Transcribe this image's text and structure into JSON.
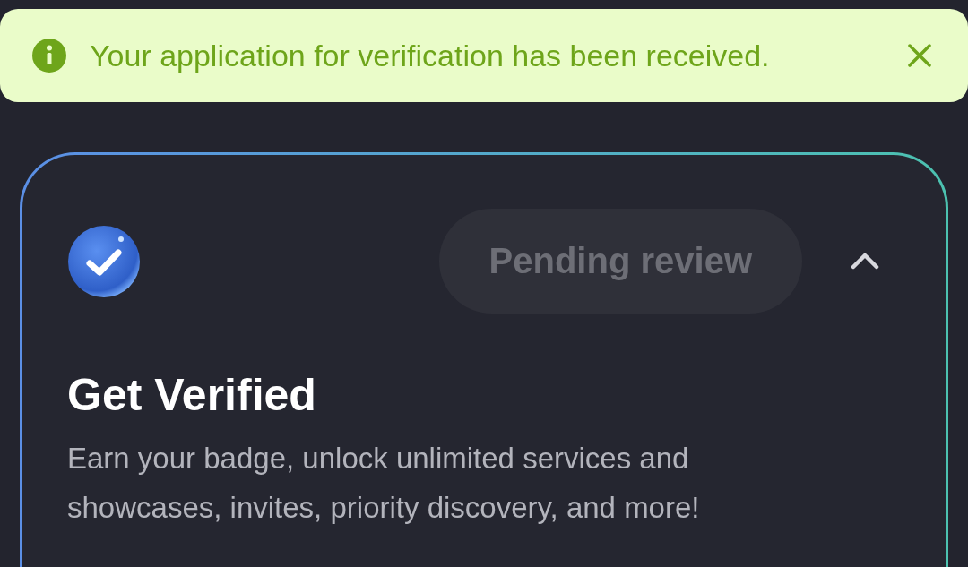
{
  "toast": {
    "message": "Your application for verification has been received.",
    "dismissible": true
  },
  "card": {
    "status": "Pending review",
    "expanded": true,
    "title": "Get Verified",
    "description": "Earn your badge, unlock unlimited services and showcases, invites, priority discovery, and more!"
  }
}
